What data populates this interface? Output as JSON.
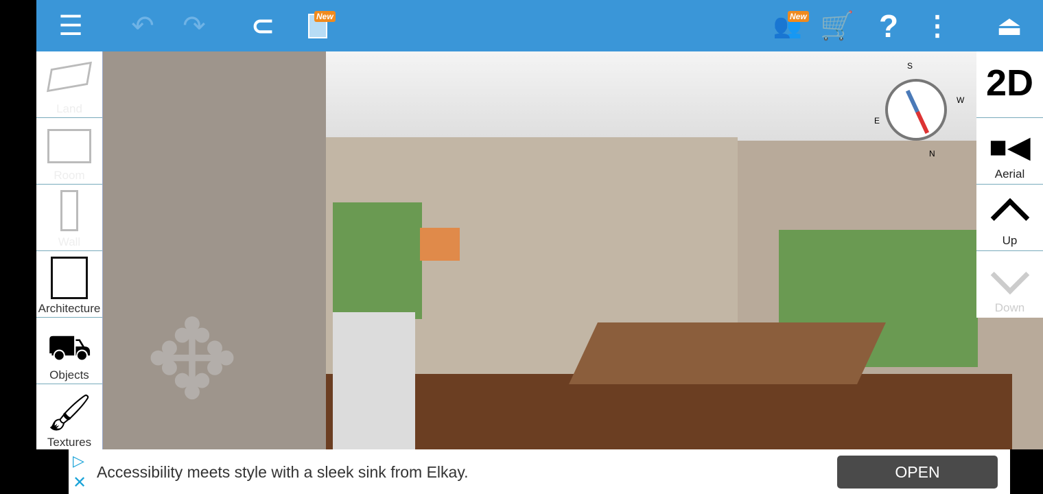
{
  "toolbar": {
    "new_badge": "New",
    "community_badge": "New",
    "icons": [
      "menu-icon",
      "undo-icon",
      "redo-icon",
      "magnet-icon",
      "layers-icon",
      "community-icon",
      "cart-icon",
      "help-icon",
      "more-icon",
      "collapse-icon"
    ]
  },
  "left_panel": {
    "items": [
      {
        "label": "Land",
        "enabled": false
      },
      {
        "label": "Room",
        "enabled": false
      },
      {
        "label": "Wall",
        "enabled": false
      },
      {
        "label": "Architecture",
        "enabled": true
      },
      {
        "label": "Objects",
        "enabled": true
      },
      {
        "label": "Textures",
        "enabled": true
      }
    ]
  },
  "right_panel": {
    "view_mode": "2D",
    "camera_label": "Aerial",
    "up_label": "Up",
    "down_label": "Down"
  },
  "compass": {
    "s": "S",
    "w": "W",
    "e": "E",
    "n": "N"
  },
  "ad": {
    "text": "Accessibility meets style with a sleek sink from Elkay.",
    "button": "OPEN"
  },
  "colors": {
    "accent": "#3a96d8"
  }
}
